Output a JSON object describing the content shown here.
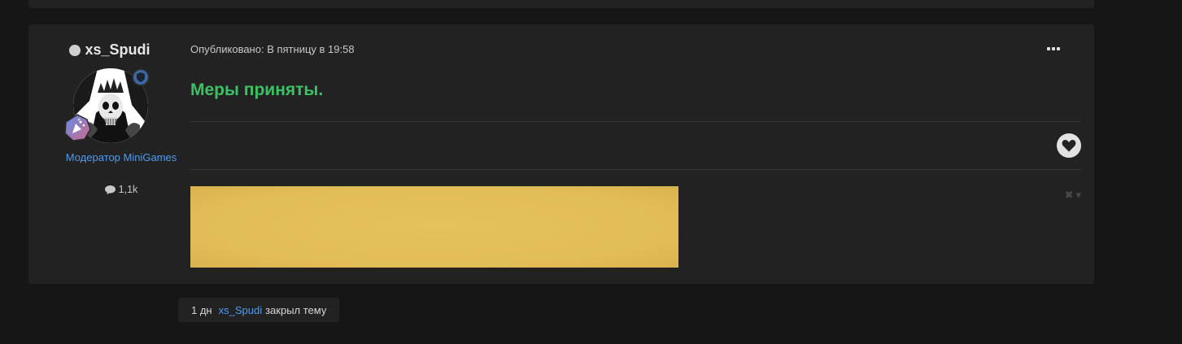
{
  "author": {
    "name": "xs_Spudi",
    "title": "Модератор MiniGames",
    "post_count": "1,1k"
  },
  "post": {
    "meta": "Опубликовано: В пятницу в 19:58",
    "body": "Меры приняты."
  },
  "event": {
    "time": "1 дн",
    "user": "xs_Spudi",
    "action": "закрыл тему"
  },
  "colors": {
    "accent_green": "#3bc163",
    "link_blue": "#4d9bf0",
    "panel_bg": "#222222",
    "page_bg": "#161616",
    "signature_yellow": "#e2bd55"
  },
  "icons": {
    "more": "ellipsis-icon",
    "like": "heart-icon",
    "comment": "speech-bubble-icon",
    "role": "shield-icon",
    "achievement": "party-popper-icon",
    "signature_close": "close-icon"
  }
}
